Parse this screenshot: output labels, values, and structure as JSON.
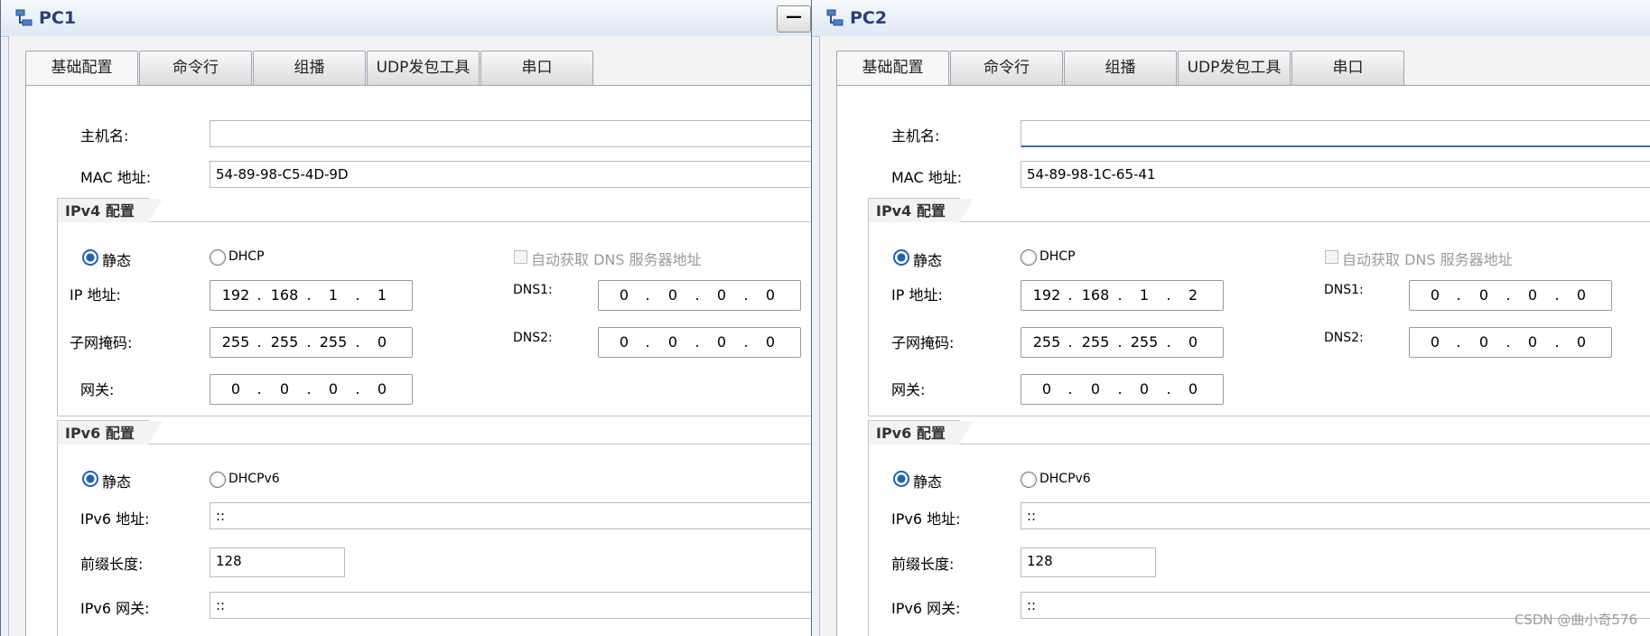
{
  "windows": [
    {
      "title": "PC1",
      "minimize_label": "—",
      "tabs": [
        "基础配置",
        "命令行",
        "组播",
        "UDP发包工具",
        "串口"
      ],
      "active_tab": "基础配置",
      "hostname_label": "主机名:",
      "hostname_value": "",
      "mac_label": "MAC 地址:",
      "mac_value": "54-89-98-C5-4D-9D",
      "ipv4": {
        "title": "IPv4 配置",
        "static_label": "静态",
        "dhcp_label": "DHCP",
        "auto_dns_label": "自动获取 DNS 服务器地址",
        "ip_label": "IP 地址:",
        "ip": [
          "192",
          "168",
          "1",
          "1"
        ],
        "mask_label": "子网掩码:",
        "mask": [
          "255",
          "255",
          "255",
          "0"
        ],
        "gateway_label": "网关:",
        "gateway": [
          "0",
          "0",
          "0",
          "0"
        ],
        "dns1_label": "DNS1:",
        "dns1": [
          "0",
          "0",
          "0",
          "0"
        ],
        "dns2_label": "DNS2:",
        "dns2": [
          "0",
          "0",
          "0",
          "0"
        ]
      },
      "ipv6": {
        "title": "IPv6 配置",
        "static_label": "静态",
        "dhcp_label": "DHCPv6",
        "addr_label": "IPv6 地址:",
        "addr_value": "::",
        "prefix_label": "前缀长度:",
        "prefix_value": "128",
        "gateway_label": "IPv6 网关:",
        "gateway_value": "::"
      }
    },
    {
      "title": "PC2",
      "minimize_label": "",
      "tabs": [
        "基础配置",
        "命令行",
        "组播",
        "UDP发包工具",
        "串口"
      ],
      "active_tab": "基础配置",
      "hostname_label": "主机名:",
      "hostname_value": "",
      "mac_label": "MAC 地址:",
      "mac_value": "54-89-98-1C-65-41",
      "ipv4": {
        "title": "IPv4 配置",
        "static_label": "静态",
        "dhcp_label": "DHCP",
        "auto_dns_label": "自动获取 DNS 服务器地址",
        "ip_label": "IP 地址:",
        "ip": [
          "192",
          "168",
          "1",
          "2"
        ],
        "mask_label": "子网掩码:",
        "mask": [
          "255",
          "255",
          "255",
          "0"
        ],
        "gateway_label": "网关:",
        "gateway": [
          "0",
          "0",
          "0",
          "0"
        ],
        "dns1_label": "DNS1:",
        "dns1": [
          "0",
          "0",
          "0",
          "0"
        ],
        "dns2_label": "DNS2:",
        "dns2": [
          "0",
          "0",
          "0",
          "0"
        ]
      },
      "ipv6": {
        "title": "IPv6 配置",
        "static_label": "静态",
        "dhcp_label": "DHCPv6",
        "addr_label": "IPv6 地址:",
        "addr_value": "::",
        "prefix_label": "前缀长度:",
        "prefix_value": "128",
        "gateway_label": "IPv6 网关:",
        "gateway_value": "::"
      }
    }
  ],
  "watermark": "CSDN @曲小奇576",
  "colors": {
    "title_text": "#2a3f77",
    "radio_selected": "#1d62b8",
    "focus_underline": "#2f6fc4"
  },
  "icons": {
    "window_icon": "network-pc-icon"
  }
}
